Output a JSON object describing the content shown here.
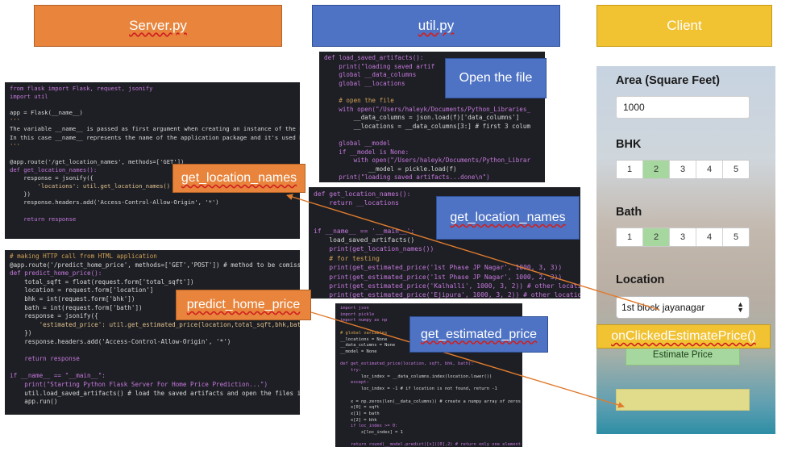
{
  "headers": {
    "server": "Server.py",
    "util": "util.py",
    "client": "Client"
  },
  "labels": {
    "glnames_server": "get_location_names",
    "predict": "predict_home_price",
    "openfile": "Open the file",
    "glnames_util": "get_location_names",
    "estprice": "get_estimated_price",
    "onclick": "onClickedEstimatePrice()"
  },
  "code": {
    "server1": [
      "from flask import Flask, request, jsonify",
      "import util",
      "",
      "app = Flask(__name__)",
      "'''",
      "The variable __name__ is passed as first argument when creating an instance of the Flask obj",
      "In this case __name__ represents the name of the application package and it's used by Flask",
      "'''",
      "",
      "@app.route('/get_location_names', methods=['GET'])",
      "def get_location_names():",
      "    response = jsonify({",
      "        'locations': util.get_location_names()",
      "    })",
      "    response.headers.add('Access-Control-Allow-Origin', '*')",
      "",
      "    return response"
    ],
    "server2": [
      "# making HTTP call from HTML application",
      "@app.route('/predict_home_price', methods=['GET','POST']) # method to be comissioned",
      "def predict_home_price():",
      "    total_sqft = float(request.form['total_sqft'])",
      "    location = request.form['location']",
      "    bhk = int(request.form['bhk'])",
      "    bath = int(request.form['bath'])",
      "    response = jsonify({",
      "        'estimated_price': util.get_estimated_price(location,total_sqft,bhk,bath)",
      "    })",
      "    response.headers.add('Access-Control-Allow-Origin', '*')",
      "",
      "    return response",
      "",
      "if __name__ == \"__main__\":",
      "    print(\"Starting Python Flask Server For Home Price Prediction...\")",
      "    util.load_saved_artifacts() # load the saved artifacts and open the files in util.py",
      "    app.run()"
    ],
    "util1": [
      "def load_saved_artifacts():",
      "    print(\"loading saved artif",
      "    global __data_columns",
      "    global __locations",
      "",
      "    # open the file",
      "    with open(\"/Users/haleyk/Documents/Python_Libraries_",
      "        __data_columns = json.load(f)['data_columns']",
      "        __locations = __data_columns[3:] # first 3 colum",
      "",
      "    global __model",
      "    if __model is None:",
      "        with open(\"/Users/haleyk/Documents/Python_Librar",
      "            __model = pickle.load(f)",
      "    print(\"loading saved artifacts...done\\n\")"
    ],
    "util2": [
      "def get_location_names():",
      "    return __locations",
      "",
      "",
      "if __name__ == '__main__':",
      "    load_saved_artifacts()",
      "    print(get_location_names())",
      "    # for testing",
      "    print(get_estimated_price('1st Phase JP Nagar', 1000, 3, 3))",
      "    print(get_estimated_price('1st Phase JP Nagar', 1000, 2, 3))",
      "    print(get_estimated_price('Kalhalli', 1000, 3, 2)) # other location",
      "    print(get_estimated_price('Ejipura', 1000, 3, 2)) # other location"
    ],
    "util3": [
      "import json",
      "import pickle",
      "import numpy as np",
      "",
      "# global variables",
      "__locations = None",
      "__data_columns = None",
      "__model = None",
      "",
      "def get_estimated_price(location, sqft, bhk, bath):",
      "    try:",
      "        loc_index = __data_columns.index(location.lower())",
      "    except:",
      "        loc_index = -1 # if location is not found, return -1",
      "",
      "    x = np.zeros(len(__data_columns)) # create a numpy array of zeros of si",
      "    x[0] = sqft",
      "    x[1] = bath",
      "    x[2] = bhk",
      "    if loc_index >= 0:",
      "        x[loc_index] = 1",
      "",
      "    return round(__model.predict([x])[0],2) # return only one element from"
    ]
  },
  "client": {
    "area_label": "Area (Square Feet)",
    "area_value": "1000",
    "bhk_label": "BHK",
    "bhk_options": [
      "1",
      "2",
      "3",
      "4",
      "5"
    ],
    "bhk_selected": "2",
    "bath_label": "Bath",
    "bath_options": [
      "1",
      "2",
      "3",
      "4",
      "5"
    ],
    "bath_selected": "2",
    "location_label": "Location",
    "location_value": "1st block jayanagar",
    "estimate_button": "Estimate Price"
  },
  "colors": {
    "orange": "#e8843c",
    "blue": "#4f73c4",
    "yellow": "#f1c232",
    "arrow": "#e07b2e",
    "selected": "#a6d79e"
  }
}
